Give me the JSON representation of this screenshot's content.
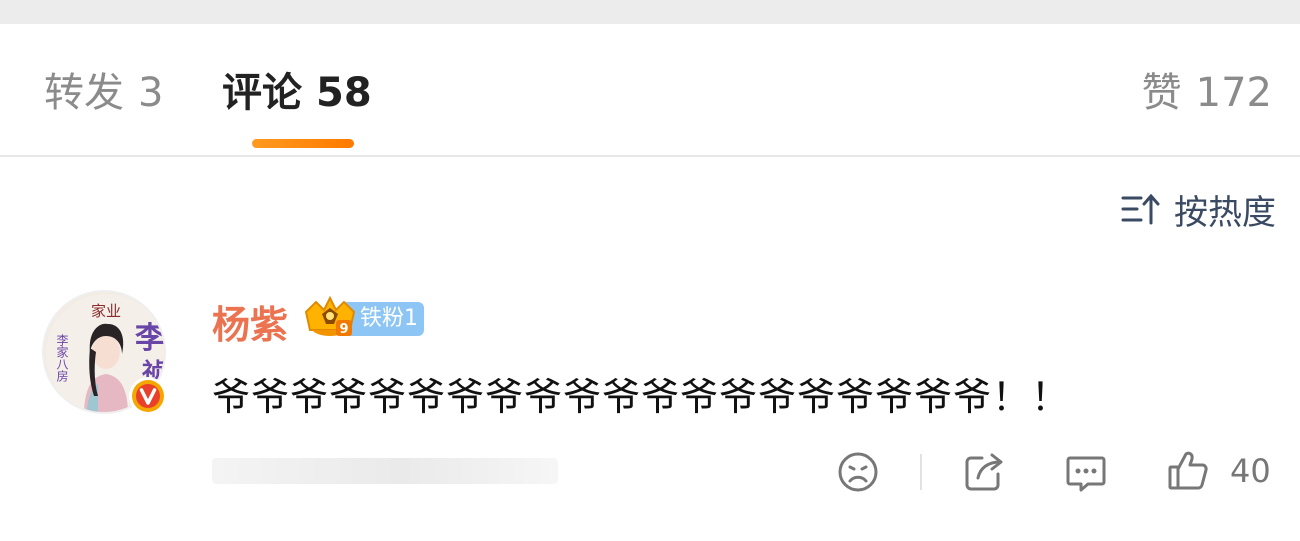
{
  "tabs": {
    "reposts": {
      "label": "转发",
      "count": "3"
    },
    "comments": {
      "label": "评论",
      "count": "58"
    },
    "likes": {
      "label": "赞",
      "count": "172"
    }
  },
  "sort": {
    "label": "按热度",
    "icon": "sort-icon"
  },
  "comment": {
    "username": "杨紫",
    "fan_badge": "铁粉1",
    "level_badge_number": "9",
    "text": "爷爷爷爷爷爷爷爷爷爷爷爷爷爷爷爷爷爷爷爷！！",
    "avatar_texts": [
      "家业",
      "李",
      "祯",
      "李家八房"
    ],
    "like_count": "40",
    "actions": [
      "dislike-icon",
      "share-icon",
      "reply-icon",
      "like-icon"
    ]
  },
  "colors": {
    "accent": "#ff8200",
    "username": "#eb7350",
    "fan_badge": "#8dc6f4",
    "verified": "#f5a600"
  }
}
